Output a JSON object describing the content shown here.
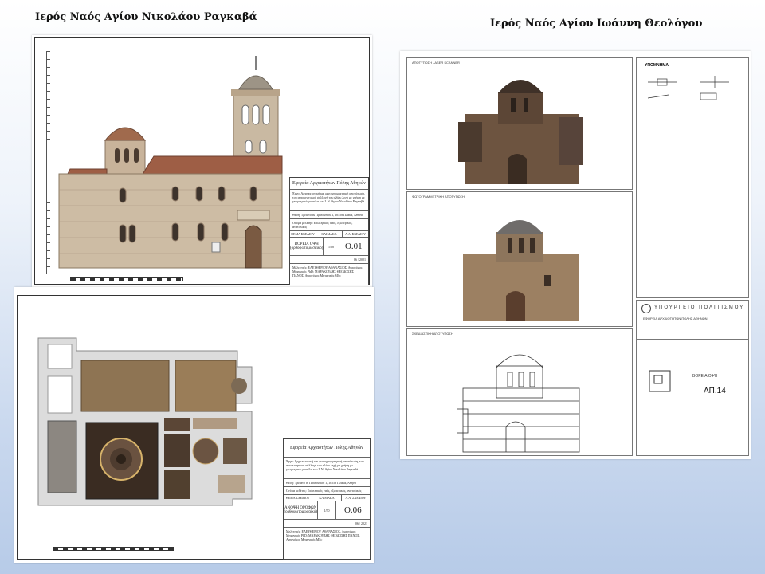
{
  "slide": {
    "left_title": "Ιερός Ναός Αγίου Νικολάου Ραγκαβά",
    "right_title": "Ιερός Ναός  Αγίου Ιωάννη Θεολόγου"
  },
  "sheet_north": {
    "header": "Εφορεία Αρχαιοτήτων Πόλης Αθηνών",
    "description": "Έργο: Αρχιτεκτονική και φωτογραμμετρική αποτύπωση, του αυτοκινητικού συλλογή του ηλίου λεχή με χρήση με γεωμετρικά μοντέλα του Ι. Ν. Αγίου Νικολάου Ραγκαβά",
    "location": "Θέση: Τρεϊάνο & Πρυτανείου 1, 10558 Πλάκα, Αθήνα",
    "subject": "Ονόμα μελέτης: Εσωτερικός ναός, εξωτερικός, ανατολικός",
    "col_labels": [
      "ΘΕΜΑ ΣΧΕΔΙΟΥ",
      "ΚΛΙΜΑΚΑ",
      "Α.Α. ΣΧΕΔΙΟΥ"
    ],
    "drawing_name": "ΒΟΡΕΙΑ ΟΨΗ (ορθοφωτομωσαϊκό)",
    "scale": "1/50",
    "code": "Ο.01",
    "date": "06 / 2021",
    "credits": "Μελετητές: ΕΛΕΥΘΕΡΙΟΥ ΑΘΑΝΑΣΙΟΣ, Αγρονόμος Μηχανικός PhD; ΜΑΡΑΚΟΥΔΗΣ ΘΕΟΔΟΣΗΣ ΠΑΝΟΣ, Αγρονόμος Μηχανικός MSc"
  },
  "sheet_roof": {
    "header": "Εφορεία Αρχαιοτήτων Πόλης Αθηνών",
    "description": "Έργο: Αρχιτεκτονική και φωτογραμμετρική αποτύπωση, του αυτοκινητικού συλλογή του ηλίου λεχή με χρήση με γεωμετρικά μοντέλα του Ι. Ν. Αγίου Νικολάου Ραγκαβά",
    "location": "Θέση: Τρεϊάνο & Πρυτανείου 1, 10558 Πλάκα, Αθήνα",
    "subject": "Ονόμα μελέτης: Εσωτερικός ναός, εξωτερικός, ανατολικός",
    "col_labels": [
      "ΘΕΜΑ ΣΧΕΔΙΟΥ",
      "ΚΛΙΜΑΚΑ",
      "Α.Α. ΣΧΕΔΙΟΥ"
    ],
    "drawing_name": "ΑΝΟΨΗ ΟΡΟΦΩΝ (ορθοφωτομωσαϊκό)",
    "scale": "1/50",
    "code": "Ο.06",
    "date": "06 / 2021",
    "credits": "Μελετητές: ΕΛΕΥΘΕΡΙΟΥ ΑΘΑΝΑΣΙΟΣ, Αγρονόμος Μηχανικός PhD; ΜΑΡΑΚΟΥΔΗΣ ΘΕΟΔΟΣΗΣ ΠΑΝΟΣ, Αγρονόμος Μηχανικός MSc"
  },
  "sheet_theologos": {
    "panel_labels": [
      "ΑΠΟΤΥΠΩΣΗ LASER SCANNER",
      "ΦΩΤΟΓΡΑΜΜΕΤΡΙΚΗ ΑΠΟΤΥΠΩΣΗ",
      "ΣΧΕΔΙΑΣΤΙΚΗ ΑΠΟΤΥΠΩΣΗ"
    ],
    "legend_title": "ΥΠΟΜΝΗΜΑ",
    "ministry": "ΥΠΟΥΡΓΕΙΟ ΠΟΛΙΤΙΣΜΟΥ",
    "ephoria": "ΕΦΟΡΕΙΑ ΑΡΧΑΙΟΤΗΤΩΝ ΠΟΛΗΣ ΑΘΗΝΩΝ",
    "drawing_name": "ΒΟΡΕΙΑ ΟΨΗ",
    "code": "ΑΠ.14"
  }
}
